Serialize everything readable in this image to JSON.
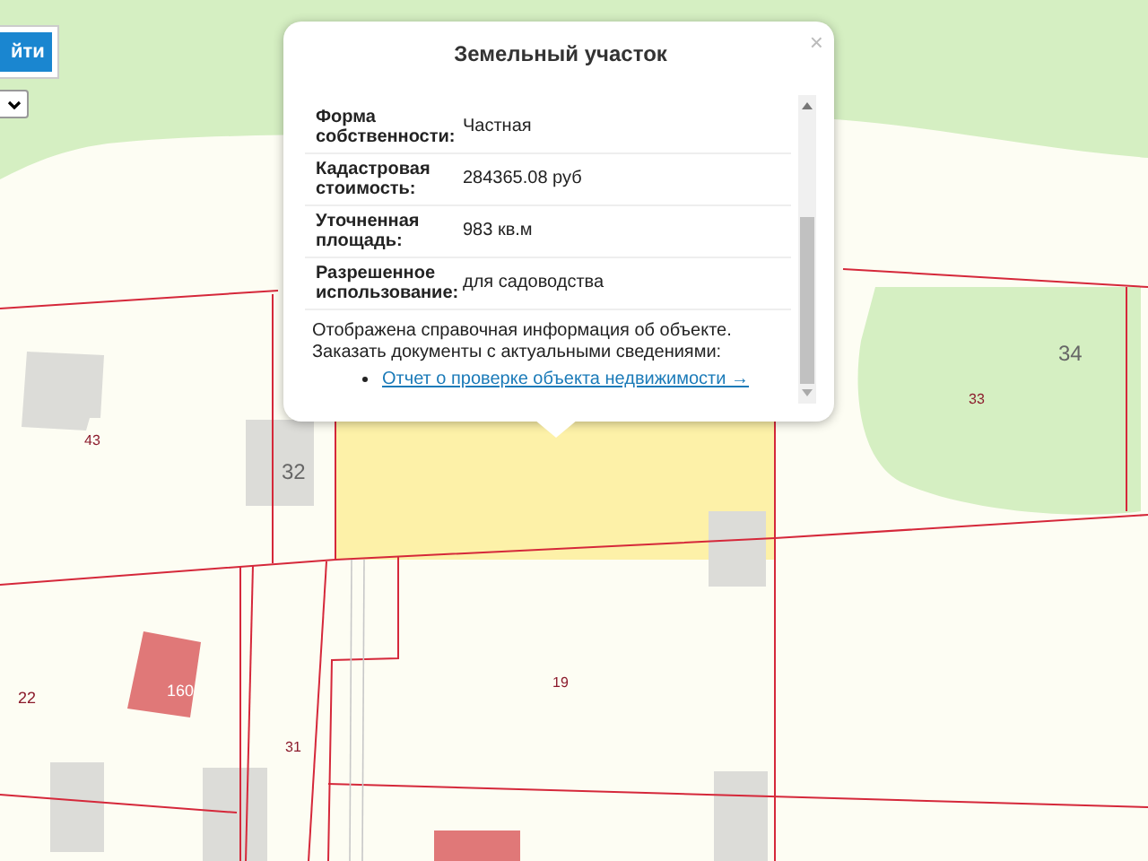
{
  "search_button": {
    "label": "йти"
  },
  "map": {
    "parcel_labels": [
      "43",
      "32",
      "33",
      "34",
      "22",
      "160",
      "31",
      "19"
    ]
  },
  "popup": {
    "title": "Земельный участок",
    "close": "×",
    "rows": [
      {
        "label": "Форма собственности:",
        "value": "Частная"
      },
      {
        "label": "Кадастровая стоимость:",
        "value": "284365.08 руб"
      },
      {
        "label": "Уточненная площадь:",
        "value": "983 кв.м"
      },
      {
        "label": "Разрешенное использование:",
        "value": "для садоводства"
      }
    ],
    "note_lines": [
      "Отображена справочная информация об объекте.",
      "Заказать документы с актуальными сведениями:"
    ],
    "link": "Отчет о проверке объекта недвижимости →"
  }
}
